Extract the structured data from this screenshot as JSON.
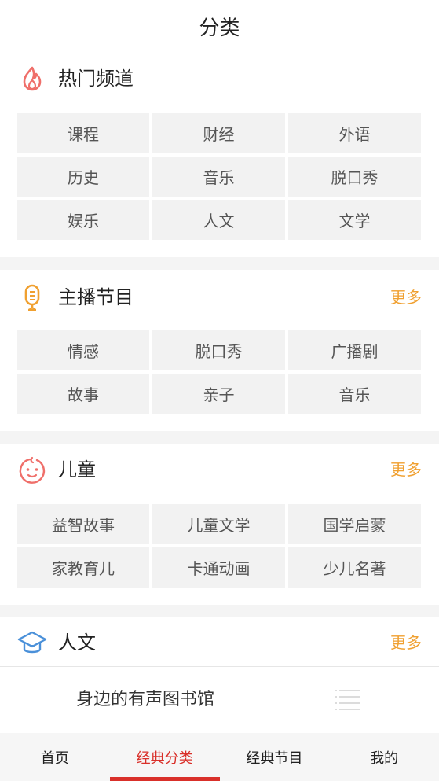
{
  "header": {
    "title": "分类"
  },
  "hot": {
    "title": "热门频道",
    "icon": "flame-icon",
    "items": [
      "课程",
      "财经",
      "外语",
      "历史",
      "音乐",
      "脱口秀",
      "娱乐",
      "人文",
      "文学"
    ]
  },
  "anchor": {
    "title": "主播节目",
    "icon": "microphone-icon",
    "more": "更多",
    "items": [
      "情感",
      "脱口秀",
      "广播剧",
      "故事",
      "亲子",
      "音乐"
    ]
  },
  "kids": {
    "title": "儿童",
    "icon": "baby-face-icon",
    "more": "更多",
    "items": [
      "益智故事",
      "儿童文学",
      "国学启蒙",
      "家教育儿",
      "卡通动画",
      "少儿名著"
    ]
  },
  "humanities": {
    "title": "人文",
    "icon": "graduation-cap-icon",
    "more": "更多"
  },
  "banner": {
    "text": "身边的有声图书馆",
    "icon": "menu-lines-icon"
  },
  "tabs": [
    {
      "label": "首页"
    },
    {
      "label": "经典分类"
    },
    {
      "label": "经典节目"
    },
    {
      "label": "我的"
    }
  ],
  "colors": {
    "accent": "#d9302a",
    "more": "#f0a030",
    "cellBg": "#f2f2f2",
    "flame": "#ef6f6a",
    "mic": "#f0a030",
    "cap": "#4a90d9"
  }
}
